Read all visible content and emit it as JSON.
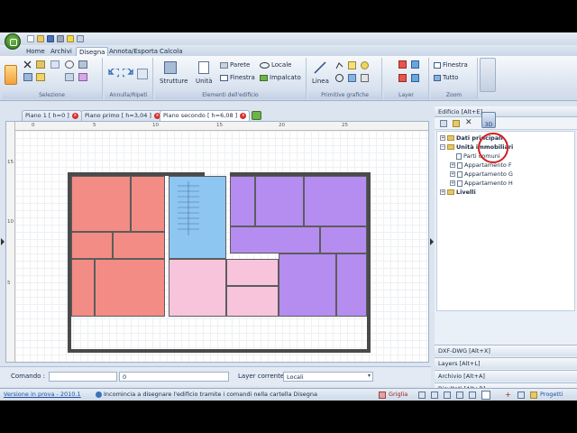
{
  "quick_access": {
    "icons": [
      "new-icon",
      "open-icon",
      "save-icon",
      "print-icon",
      "undo-icon",
      "options-icon"
    ]
  },
  "menu_tabs": [
    "Home",
    "Archivi",
    "Disegna",
    "Annota/Esporta",
    "Calcola"
  ],
  "active_menu_tab": "Disegna",
  "ribbon": {
    "groups": {
      "selezione": "Selezione",
      "annulla": "Annulla/Ripeti",
      "elementi": "Elementi dell'edificio",
      "primitive": "Primitive grafiche",
      "layer": "Layer",
      "zoom": "Zoom"
    },
    "buttons": {
      "strutture": "Strutture",
      "unita": "Unità",
      "parete": "Parete",
      "finestra": "Finestra",
      "locale": "Locale",
      "impalcato": "Impalcato",
      "linea": "Linea",
      "zoom_finestra": "Finestra",
      "zoom_tutto": "Tutto"
    }
  },
  "document_tabs": [
    {
      "label": "Piano 1 [ h=0 ]"
    },
    {
      "label": "Piano primo [ h=3,04 ]"
    },
    {
      "label": "Piano secondo [ h=6,08 ]"
    }
  ],
  "ruler": {
    "h_ticks": [
      "0",
      "5",
      "10",
      "15",
      "20",
      "25"
    ],
    "v_ticks": [
      "15",
      "10",
      "5"
    ]
  },
  "right_panel": {
    "header": "Edificio [Alt+E]",
    "badge_3d": "3D",
    "tree": {
      "dati": "Dati principali",
      "unita": "Unità immobiliari",
      "parti": "Parti comuni",
      "app_f": "Appartamento F",
      "app_g": "Appartamento G",
      "app_h": "Appartamento H",
      "livelli": "Livelli"
    },
    "accordion": [
      "DXF-DWG [Alt+X]",
      "Layers [Alt+L]",
      "Archivio [Alt+A]",
      "Risultati [Alt+R]"
    ]
  },
  "command_bar": {
    "label": "Comando :",
    "value": "0",
    "layer_label": "Layer corrente",
    "layer_value": "Locali"
  },
  "status": {
    "version": "Versione in prova - 2010.1",
    "message": "Incomincia a disegnare l'edificio tramite i comandi nella cartella Disegna",
    "griglia": "Griglia",
    "progetti": "Progetti"
  },
  "colors": {
    "apt_red": "#f28c84",
    "apt_blue": "#8ec6f2",
    "apt_pink": "#f7c4dc",
    "apt_purple": "#b58cf0",
    "accent": "#d21e1e"
  }
}
